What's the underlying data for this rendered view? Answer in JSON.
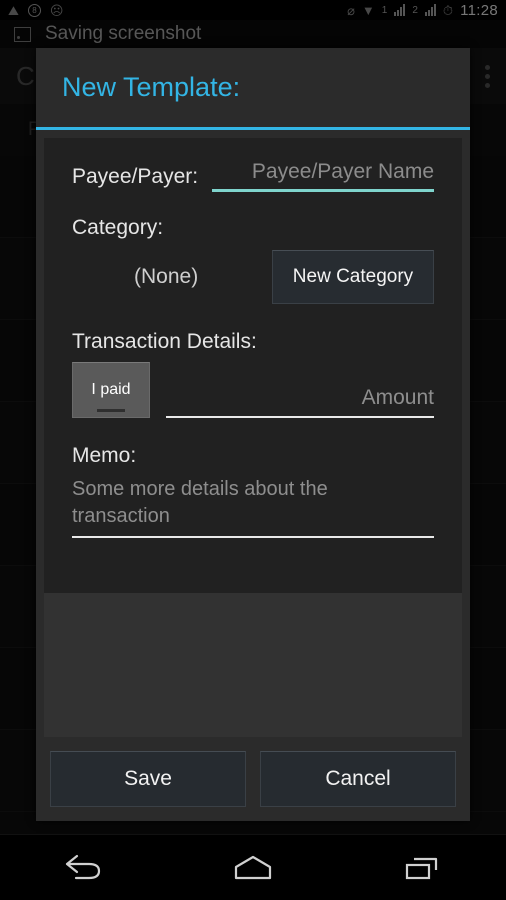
{
  "statusbar": {
    "time": "11:28",
    "sim_label": "1",
    "sim2_label": "2",
    "icons": [
      {
        "name": "image-icon",
        "glyph": "⛰"
      },
      {
        "name": "headset-badge-icon",
        "glyph": "8"
      },
      {
        "name": "ghost-icon",
        "glyph": "◕"
      },
      {
        "name": "mute-icon",
        "glyph": "⌀"
      },
      {
        "name": "wifi-icon",
        "glyph": "▼"
      },
      {
        "name": "alarm-icon",
        "glyph": "○"
      }
    ]
  },
  "notification": {
    "icon": "screenshot-icon",
    "text": "Saving screenshot"
  },
  "background_app": {
    "title": "C",
    "overflow_icon": "overflow-menu-icon",
    "subheader": "P",
    "row_count": 8
  },
  "dialog": {
    "title": "New Template:",
    "accent_color": "#33b5e5",
    "payee": {
      "label": "Payee/Payer:",
      "placeholder": "Payee/Payer Name",
      "value": "",
      "underline_color": "#7fd4cd"
    },
    "category": {
      "label": "Category:",
      "selected": "(None)",
      "new_button": "New Category"
    },
    "transaction": {
      "label": "Transaction Details:",
      "direction_toggle": "I paid",
      "amount_placeholder": "Amount",
      "amount_value": ""
    },
    "memo": {
      "label": "Memo:",
      "placeholder": "Some more details about the transaction",
      "value": ""
    },
    "buttons": {
      "save": "Save",
      "cancel": "Cancel"
    }
  },
  "navbar": {
    "back": "back-icon",
    "home": "home-icon",
    "recents": "recents-icon"
  }
}
